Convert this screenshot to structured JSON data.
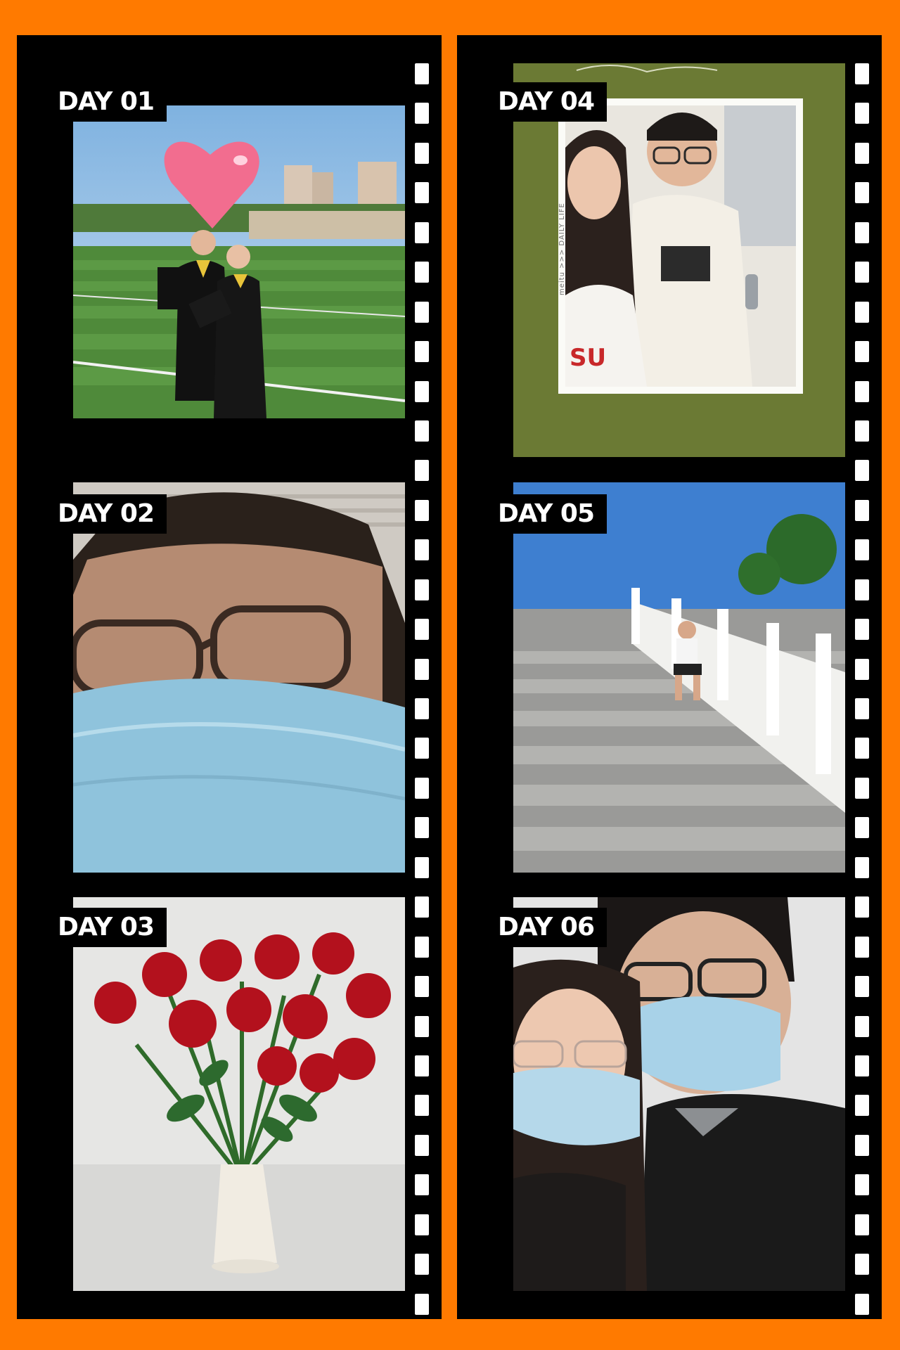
{
  "collage": {
    "left_column": {
      "frame1_label": "DAY 01",
      "frame2_label": "DAY 02",
      "frame3_label": "DAY 03"
    },
    "right_column": {
      "frame4_label": "DAY 04",
      "frame5_label": "DAY 05",
      "frame6_label": "DAY 06"
    },
    "frame4_watermark": "meitu >>> DAILY LIFE"
  },
  "colors": {
    "background": "#ff7a00",
    "film": "#000000",
    "sprocket": "#ffffff",
    "day04_frame": "#6b7a34"
  },
  "icons": {
    "heart_sticker": "heart-icon"
  }
}
